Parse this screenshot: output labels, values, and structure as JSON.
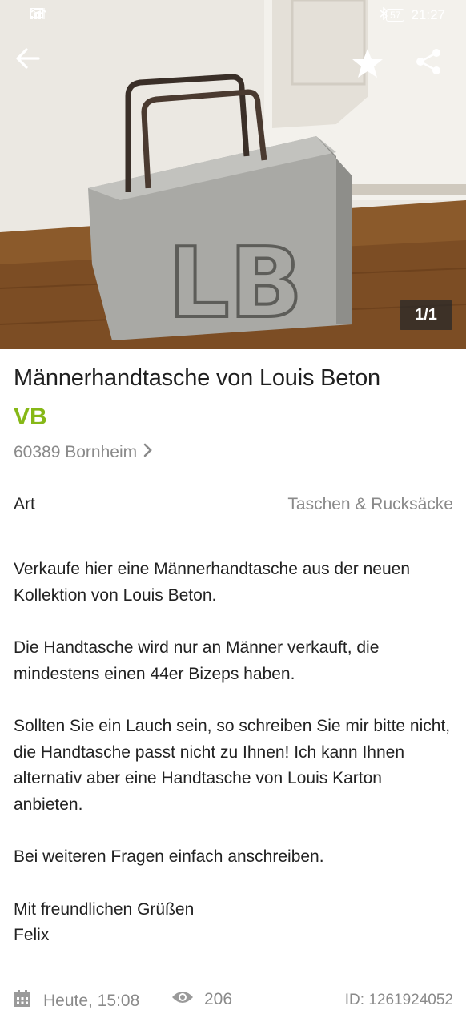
{
  "status_bar": {
    "battery": "57",
    "time": "21:27"
  },
  "gallery": {
    "counter": "1/1",
    "image_text": "LB"
  },
  "listing": {
    "title": "Männerhandtasche von Louis Beton",
    "price": "VB",
    "location": "60389 Bornheim",
    "attribute": {
      "label": "Art",
      "value": "Taschen & Rucksäcke"
    },
    "description": [
      "Verkaufe hier eine Männerhandtasche aus der neuen Kollektion von Louis Beton.",
      "Die Handtasche wird nur an Männer verkauft, die mindestens einen 44er Bizeps haben.",
      "Sollten Sie ein Lauch sein, so schreiben Sie mir bitte nicht, die Handtasche passt nicht zu Ihnen! Ich kann Ihnen alternativ aber eine Handtasche von Louis Karton anbieten.",
      "Bei weiteren Fragen einfach anschreiben.",
      "Mit freundlichen Grüßen\nFelix"
    ],
    "posted": "Heute, 15:08",
    "views": "206",
    "ad_id": "ID: 1261924052"
  },
  "icons": {
    "back": "arrow-left-icon",
    "favorite": "star-icon",
    "share": "share-icon",
    "location_chevron": "chevron-right-icon",
    "date": "calendar-icon",
    "views": "eye-icon"
  },
  "colors": {
    "price": "#86b817",
    "muted_text": "#8a8a8a"
  }
}
